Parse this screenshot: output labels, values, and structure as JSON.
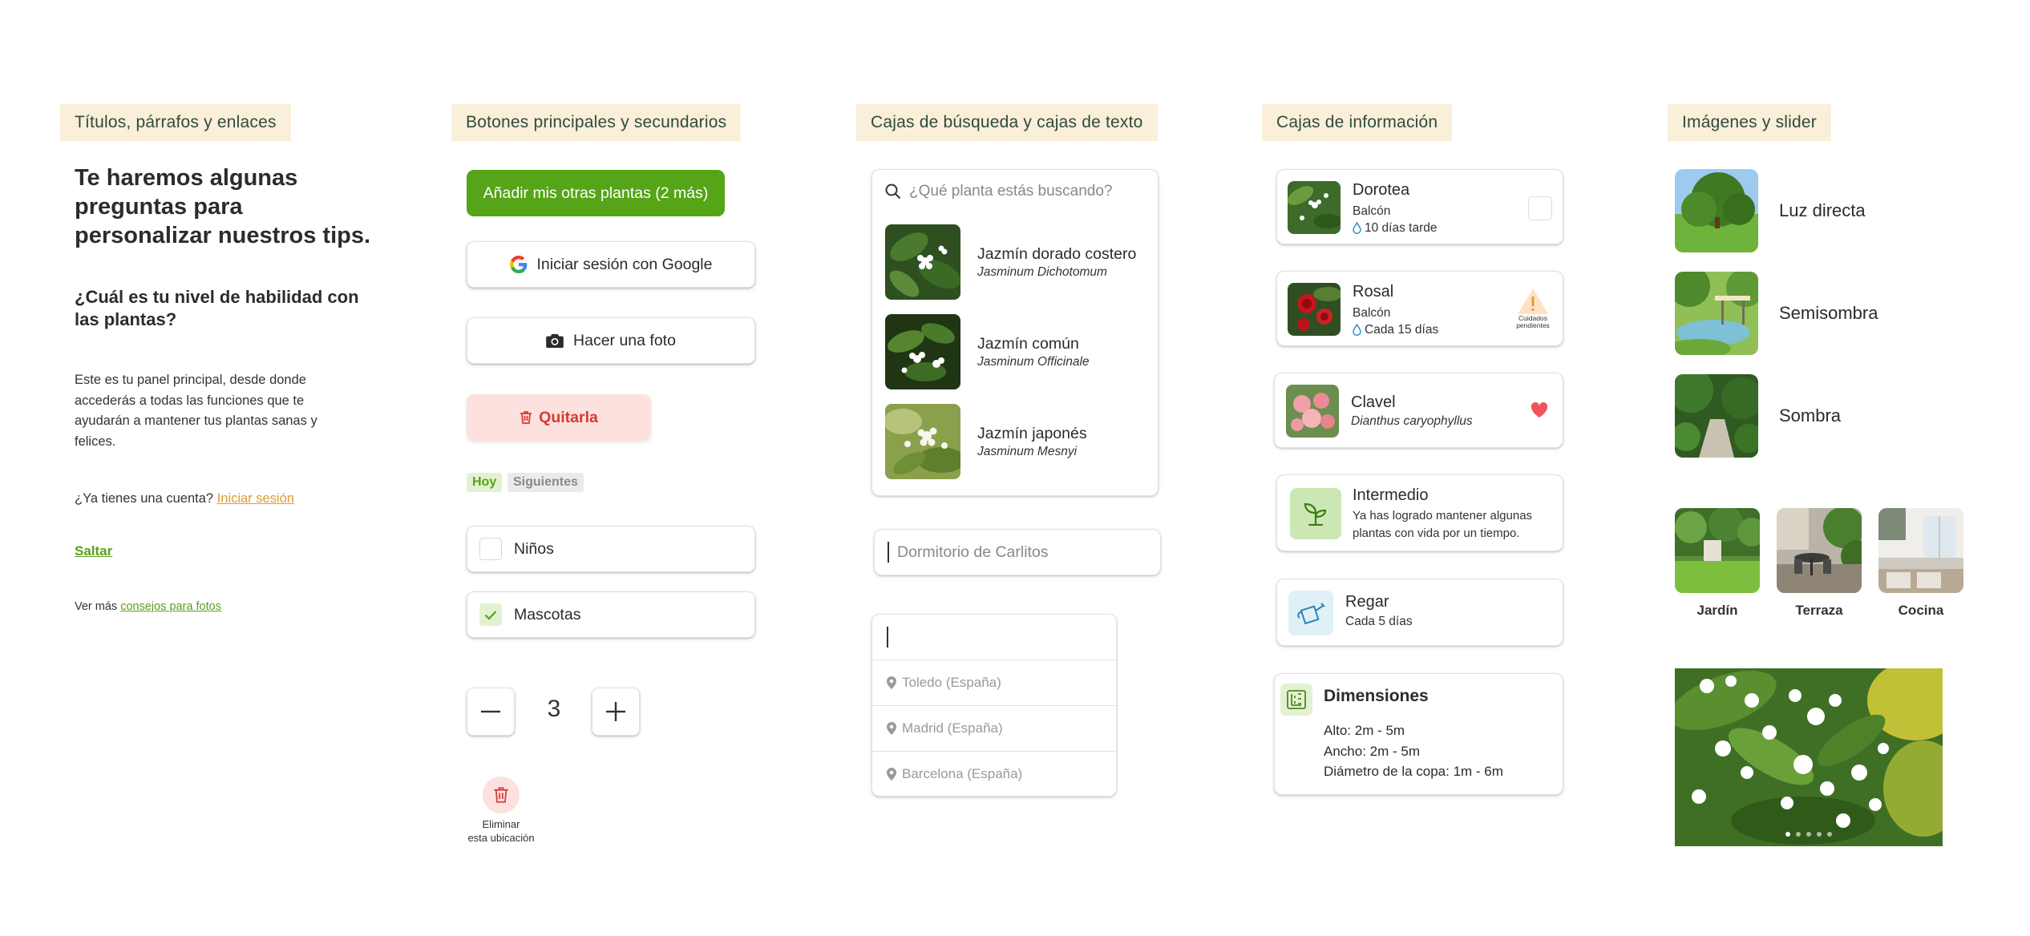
{
  "sections": {
    "typography": "Títulos, párrafos y enlaces",
    "buttons": "Botones principales y secundarios",
    "search": "Cajas de búsqueda y cajas de texto",
    "info": "Cajas de información",
    "images": "Imágenes y slider"
  },
  "typography": {
    "title": "Te haremos algunas preguntas para personalizar nuestros tips.",
    "question": "¿Cuál es tu nivel de habilidad con las plantas?",
    "paragraph": "Este es tu panel principal, desde donde accederás a todas las funciones que te ayudarán a mantener tus plantas sanas y felices.",
    "account_prompt": "¿Ya tienes una cuenta?",
    "login_link": "Iniciar sesión",
    "skip_link": "Saltar",
    "see_more_prefix": "Ver más",
    "photo_tips_link": "consejos para fotos"
  },
  "buttons": {
    "add_plants": "Añadir mis otras plantas (2 más)",
    "google_login": "Iniciar sesión con Google",
    "take_photo": "Hacer una foto",
    "remove": "Quitarla",
    "tab_today": "Hoy",
    "tab_next": "Siguientes",
    "check_children": "Niños",
    "check_pets": "Mascotas",
    "quantity": "3",
    "delete_location_line1": "Eliminar",
    "delete_location_line2": "esta ubicación"
  },
  "search": {
    "placeholder": "¿Qué planta estás buscando?",
    "results": [
      {
        "name": "Jazmín dorado costero",
        "sci": "Jasminum Dichotomum"
      },
      {
        "name": "Jazmín común",
        "sci": "Jasminum Officinale"
      },
      {
        "name": "Jazmín japonés",
        "sci": "Jasminum Mesnyi"
      }
    ],
    "text_value": "Dormitorio de Carlitos",
    "locations": [
      "Toledo (España)",
      "Madrid (España)",
      "Barcelona (España)"
    ]
  },
  "info": {
    "plant1": {
      "name": "Dorotea",
      "place": "Balcón",
      "status": "10 días tarde"
    },
    "plant2": {
      "name": "Rosal",
      "place": "Balcón",
      "status": "Cada 15 días",
      "badge_line1": "Cuidados",
      "badge_line2": "pendientes"
    },
    "plant3": {
      "name": "Clavel",
      "sci": "Dianthus caryophyllus"
    },
    "level": {
      "title": "Intermedio",
      "desc": "Ya has logrado mantener algunas plantas con vida por un tiempo."
    },
    "water": {
      "title": "Regar",
      "desc": "Cada 5 días"
    },
    "dims": {
      "title": "Dimensiones",
      "height": "Alto: 2m - 5m",
      "width": "Ancho: 2m - 5m",
      "crown": "Diámetro de la copa: 1m - 6m"
    }
  },
  "images": {
    "light": [
      "Luz directa",
      "Semisombra",
      "Sombra"
    ],
    "rooms": [
      "Jardín",
      "Terraza",
      "Cocina"
    ],
    "slider_dots": 5,
    "slider_active": 0
  },
  "colors": {
    "primary_green": "#56a418",
    "tag_bg": "#faefd9",
    "danger_bg": "#fde1df",
    "danger_text": "#d83a34",
    "link_orange": "#e19a2f",
    "heart_red": "#f0545a"
  }
}
